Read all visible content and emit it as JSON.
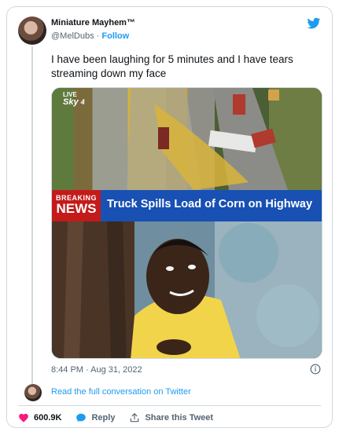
{
  "author": {
    "name": "Miniature Mayhem™",
    "handle": "@MelDubs",
    "separator": "·",
    "follow_label": "Follow"
  },
  "tweet": {
    "text": "I have been laughing for 5 minutes and I have tears streaming down my face",
    "timestamp": "8:44 PM · Aug 31, 2022"
  },
  "media": {
    "live_label": "LIVE",
    "channel_label": "Sky",
    "channel_number": "4",
    "breaking_line1": "BREAKING",
    "breaking_line2": "NEWS",
    "headline": "Truck Spills Load of Corn on Highway"
  },
  "conversation": {
    "link_text": "Read the full conversation on Twitter"
  },
  "actions": {
    "likes_count": "600.9K",
    "reply_label": "Reply",
    "share_label": "Share this Tweet"
  },
  "colors": {
    "accent": "#1d9bf0",
    "like": "#f91880",
    "breaking_red": "#c41a1a",
    "headline_blue": "#1850b3"
  },
  "icons": [
    "twitter-bird-icon",
    "info-icon",
    "heart-icon",
    "reply-icon",
    "share-icon"
  ]
}
